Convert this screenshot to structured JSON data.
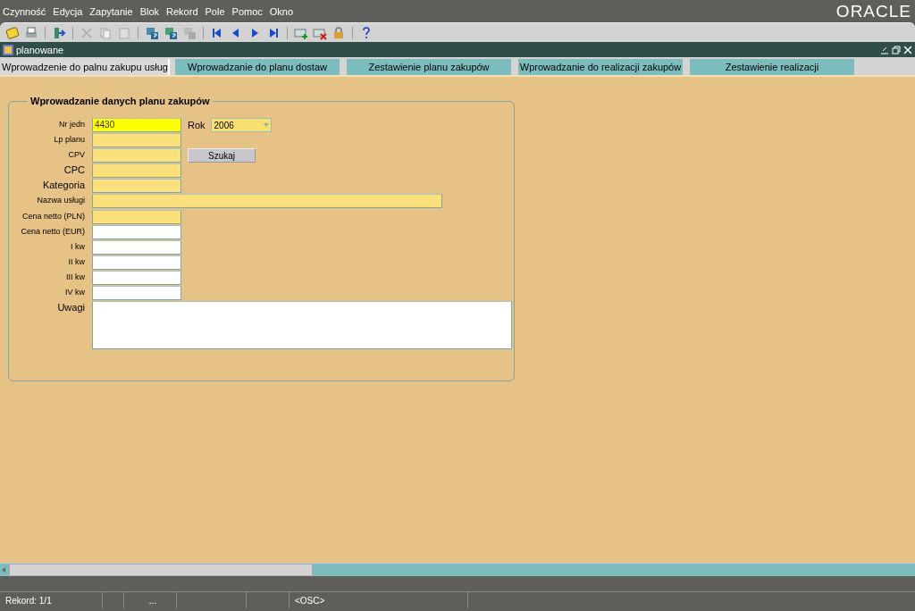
{
  "menu": [
    "Czynność",
    "Edycja",
    "Zapytanie",
    "Blok",
    "Rekord",
    "Pole",
    "Pomoc",
    "Okno"
  ],
  "brand": "ORACLE",
  "window": {
    "title": "planowane"
  },
  "tabs": [
    {
      "label": "Wprowadzenie do palnu zakupu usług",
      "selected": true
    },
    {
      "label": "Wprowadzanie do planu dostaw",
      "selected": false
    },
    {
      "label": "Zestawienie planu zakupów",
      "selected": false
    },
    {
      "label": "Wprowadzanie do realizacji zakupów",
      "selected": false
    },
    {
      "label": "Zestawienie realizacji",
      "selected": false
    }
  ],
  "group": {
    "title": "Wprowadzanie danych planu zakupów",
    "fields": [
      {
        "label": "Nr jedn",
        "kind": "short",
        "required": true,
        "focused": true,
        "value": "4430"
      },
      {
        "label": "Lp planu",
        "kind": "short",
        "required": true,
        "focused": false
      },
      {
        "label": "CPV",
        "kind": "short",
        "required": true,
        "focused": false
      },
      {
        "label": "CPC",
        "kind": "short",
        "required": true,
        "focused": false
      },
      {
        "label": "Kategoria",
        "kind": "short",
        "required": true,
        "focused": false
      },
      {
        "label": "Nazwa usługi",
        "kind": "long",
        "required": true,
        "focused": false
      },
      {
        "label": "Cena netto (PLN)",
        "kind": "short",
        "required": true,
        "focused": false
      },
      {
        "label": "Cena netto (EUR)",
        "kind": "short",
        "required": false,
        "focused": false
      },
      {
        "label": "I kw",
        "kind": "short",
        "required": false,
        "focused": false
      },
      {
        "label": "II kw",
        "kind": "short",
        "required": false,
        "focused": false
      },
      {
        "label": "III kw",
        "kind": "short",
        "required": false,
        "focused": false
      },
      {
        "label": "IV kw",
        "kind": "short",
        "required": false,
        "focused": false
      },
      {
        "label": "Uwagi",
        "kind": "memo",
        "required": false,
        "focused": false
      }
    ],
    "year": {
      "label": "Rok",
      "value": "2006"
    },
    "search_button": "Szukaj"
  },
  "status_bar": {
    "record": "Rekord: 1/1",
    "cell_3": "...",
    "mode": "<OSC>"
  }
}
